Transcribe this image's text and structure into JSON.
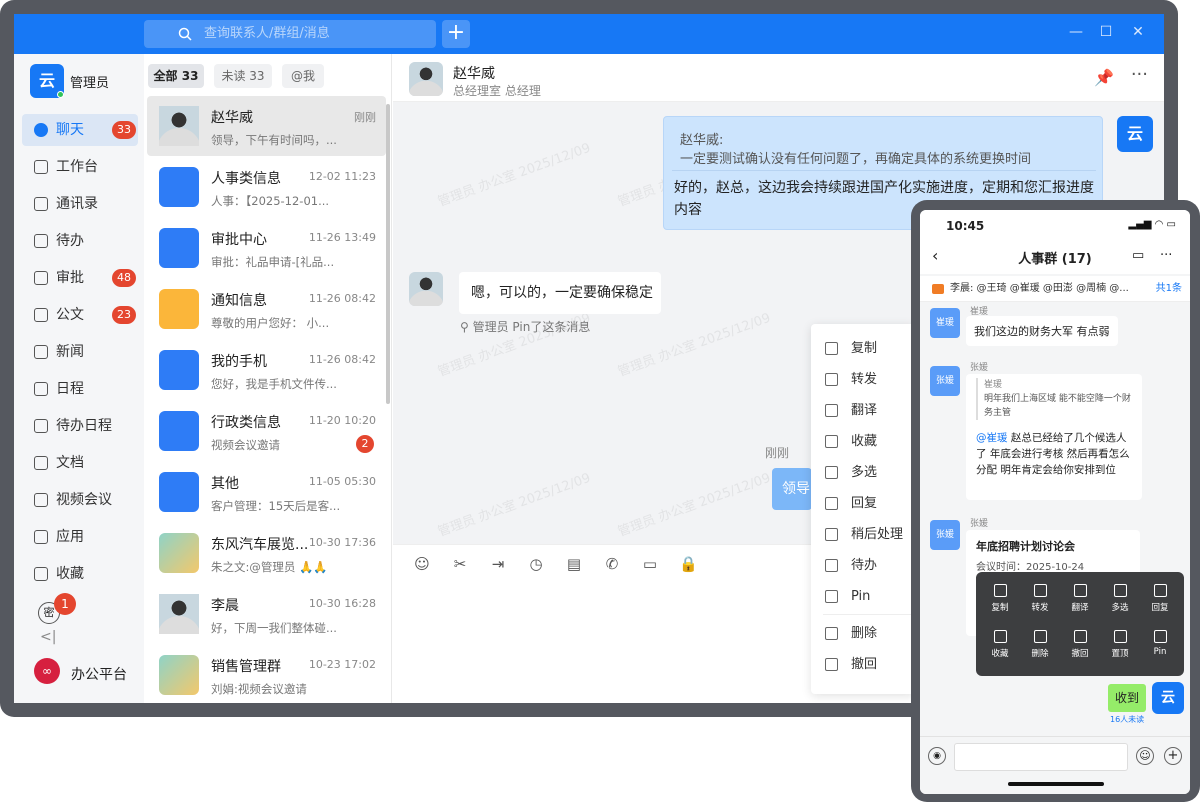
{
  "search": {
    "placeholder": "查询联系人/群组/消息"
  },
  "me": {
    "name": "管理员",
    "logo": "云"
  },
  "nav": [
    {
      "label": "聊天",
      "badge": "33",
      "icon": "chat-icon"
    },
    {
      "label": "工作台",
      "badge": "",
      "icon": "workbench-icon"
    },
    {
      "label": "通讯录",
      "badge": "",
      "icon": "contacts-icon"
    },
    {
      "label": "待办",
      "badge": "",
      "icon": "todo-icon"
    },
    {
      "label": "审批",
      "badge": "48",
      "icon": "approval-icon"
    },
    {
      "label": "公文",
      "badge": "23",
      "icon": "document-icon"
    },
    {
      "label": "新闻",
      "badge": "",
      "icon": "news-icon"
    },
    {
      "label": "日程",
      "badge": "",
      "icon": "calendar-icon"
    },
    {
      "label": "待办日程",
      "badge": "",
      "icon": "schedule-icon"
    },
    {
      "label": "文档",
      "badge": "",
      "icon": "doc-icon"
    },
    {
      "label": "视频会议",
      "badge": "",
      "icon": "video-icon"
    },
    {
      "label": "应用",
      "badge": "",
      "icon": "apps-icon"
    },
    {
      "label": "收藏",
      "badge": "",
      "icon": "star-icon"
    }
  ],
  "nav_secret": {
    "label": "密",
    "badge": "1"
  },
  "platform": {
    "icon_label": "∞",
    "label": "办公平台"
  },
  "tabs": [
    "全部 33",
    "未读 33",
    "@我"
  ],
  "conversations": [
    {
      "name": "赵华威",
      "time": "刚刚",
      "preview": "领导，下午有时间吗，...",
      "badge": "",
      "icon": "person-avatar"
    },
    {
      "name": "人事类信息",
      "time": "12-02 11:23",
      "preview": "人事：【2025-12-01...",
      "badge": "",
      "icon": "hr-icon",
      "color": "#2e7cf6"
    },
    {
      "name": "审批中心",
      "time": "11-26 13:49",
      "preview": "审批：礼品申请-[礼品...",
      "badge": "",
      "icon": "approval-icon",
      "color": "#2e7cf6"
    },
    {
      "name": "通知信息",
      "time": "11-26 08:42",
      "preview": "尊敬的用户您好：  小...",
      "badge": "",
      "icon": "bell-icon",
      "color": "#fbb63a"
    },
    {
      "name": "我的手机",
      "time": "11-26 08:42",
      "preview": "您好，我是手机文件传...",
      "badge": "",
      "icon": "phone-icon",
      "color": "#2e7cf6"
    },
    {
      "name": "行政类信息",
      "time": "11-20 10:20",
      "preview": "视频会议邀请",
      "badge": "2",
      "icon": "admin-icon",
      "color": "#2e7cf6"
    },
    {
      "name": "其他",
      "time": "11-05 05:30",
      "preview": "客户管理：15天后是客...",
      "badge": "",
      "icon": "grid-icon",
      "color": "#2e7cf6"
    },
    {
      "name": "东风汽车展览...",
      "time": "10-30 17:36",
      "preview": "朱之文:@管理员 🙏🙏",
      "badge": "",
      "icon": "group-avatar"
    },
    {
      "name": "李晨",
      "time": "10-30 16:28",
      "preview": "好，下周一我们整体碰...",
      "badge": "",
      "icon": "person-avatar"
    },
    {
      "name": "销售管理群",
      "time": "10-23 17:02",
      "preview": "刘娟:视频会议邀请",
      "badge": "",
      "icon": "group-avatar"
    }
  ],
  "chat": {
    "name": "赵华威",
    "subtitle": "总经理室 总经理",
    "quote_name": "赵华威:",
    "quote_text": "一定要测试确认没有任何问题了，再确定具体的系统更换时间",
    "reply": "好的，赵总，这边我会持续跟进国产化实施进度，定期和您汇报进度内容",
    "peer_msg": "嗯，可以的，一定要确保稳定",
    "pinned_note": "管理员 Pin了这条消息",
    "time_label": "刚刚",
    "cut_msg": "领导",
    "watermark": "管理员 办公室 2025/12/09"
  },
  "context_menu": [
    "复制",
    "转发",
    "翻译",
    "收藏",
    "多选",
    "回复",
    "稍后处理",
    "待办",
    "Pin",
    "删除",
    "撤回"
  ],
  "tools": [
    "emoji-icon",
    "scissors-icon",
    "forward-icon",
    "history-icon",
    "note-icon",
    "call-icon",
    "folder-icon",
    "lock-icon"
  ],
  "phone": {
    "time": "10:45",
    "title": "人事群 (17)",
    "pin_text": "李晨: @王琦 @崔瑗 @田澎 @周楠 @...",
    "pin_count": "共1条",
    "msg1_sender": "崔瑗",
    "msg1_avatar": "崔瑗",
    "msg1_text": "我们这边的财务大军 有点弱",
    "msg2_sender": "张媛",
    "msg2_avatar": "张媛",
    "msg2_quote_name": "崔瑗",
    "msg2_quote_text": "明年我们上海区域  能不能空降一个财务主管",
    "msg2_mention": "@崔瑗",
    "msg2_text": "赵总已经给了几个候选人了  年底会进行考核  然后再看怎么分配 明年肯定会给你安排到位",
    "msg3_sender": "张媛",
    "msg3_avatar": "张媛",
    "msg3_title": "年底招聘计划讨论会",
    "msg3_time": "会议时间：2025-10-24",
    "menu": [
      "复制",
      "转发",
      "翻译",
      "多选",
      "回复",
      "收藏",
      "删除",
      "撤回",
      "置顶",
      "Pin"
    ],
    "recv": "收到",
    "unread": "16人未读"
  }
}
